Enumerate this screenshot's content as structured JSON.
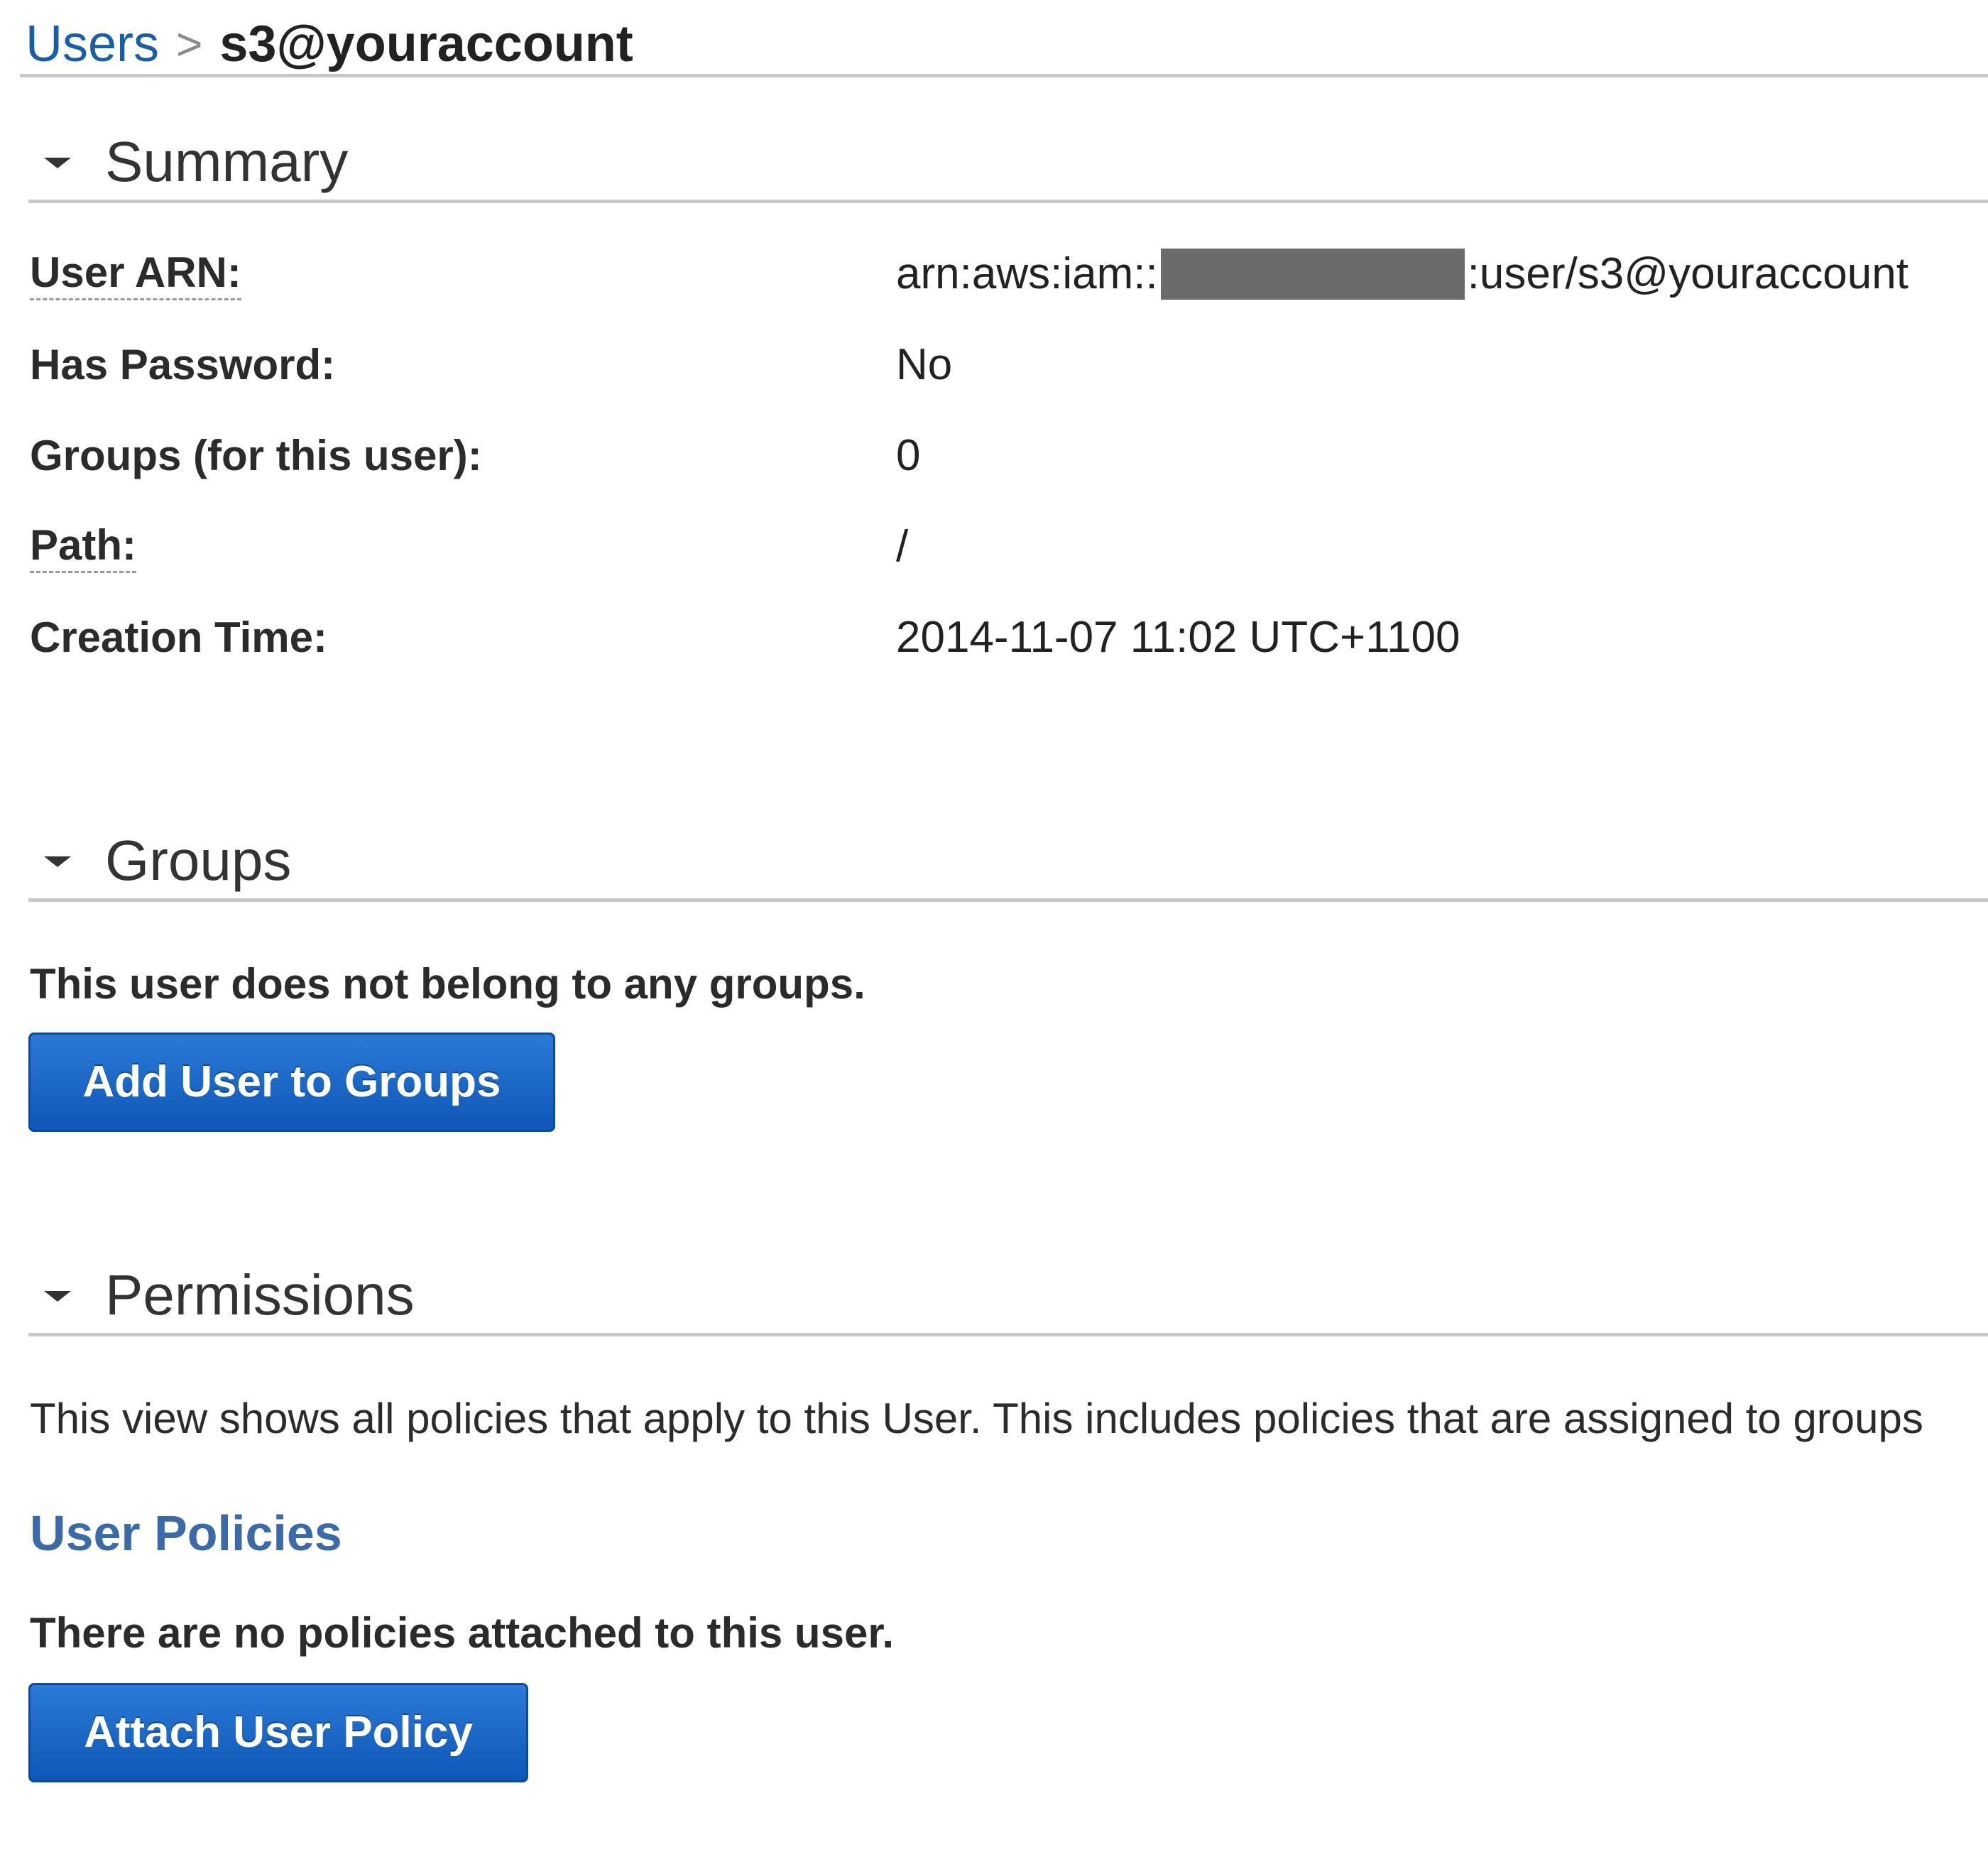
{
  "breadcrumb": {
    "parent_label": "Users",
    "separator": ">",
    "current_label": "s3@youraccount"
  },
  "summary": {
    "header": "Summary",
    "fields": [
      {
        "label": "User ARN:",
        "value_prefix": "arn:aws:iam::",
        "value_suffix": ":user/s3@youraccount"
      },
      {
        "label": "Has Password:",
        "value": "No"
      },
      {
        "label": "Groups (for this user):",
        "value": "0"
      },
      {
        "label": "Path:",
        "value": "/"
      },
      {
        "label": "Creation Time:",
        "value": "2014-11-07 11:02 UTC+1100"
      }
    ]
  },
  "groups": {
    "header": "Groups",
    "empty_message": "This user does not belong to any groups.",
    "add_button_label": "Add User to Groups"
  },
  "permissions": {
    "header": "Permissions",
    "description": "This view shows all policies that apply to this User. This includes policies that are assigned to groups",
    "user_policies_heading": "User Policies",
    "empty_message": "There are no policies attached to this user.",
    "attach_button_label": "Attach User Policy"
  },
  "colors": {
    "link": "#1a5ea8",
    "subheading": "#3a6aa8",
    "button": "#1565c8",
    "redaction": "#6b6b6b"
  },
  "icons": {
    "section_toggle": "caret-down-icon"
  }
}
